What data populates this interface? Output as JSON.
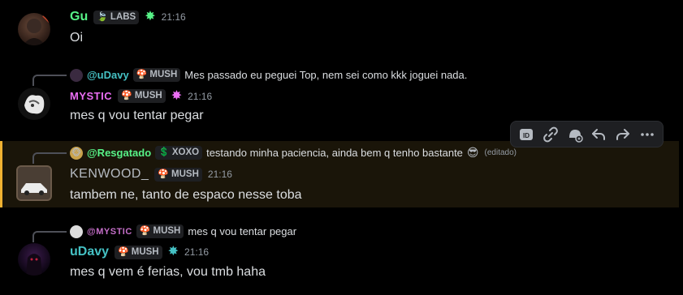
{
  "messages": [
    {
      "author": "Gu",
      "author_color": "#57f287",
      "tag": {
        "icon": "leaf-icon",
        "label": "LABS"
      },
      "badge": "green-star-icon",
      "time": "21:16",
      "content": "Oi"
    },
    {
      "reply": {
        "author": "@uDavy",
        "author_color": "#45c1c4",
        "tag": "MUSH",
        "text": "Mes passado eu peguei Top, nem sei como kkk joguei nada."
      },
      "author": "MYSTIC",
      "author_color": "#eb6ef4",
      "tag": {
        "icon": "mushroom-icon",
        "label": "MUSH"
      },
      "badge": "pink-star-icon",
      "time": "21:16",
      "content": "mes q vou tentar pegar"
    },
    {
      "reply": {
        "author": "@Resgatado",
        "author_color": "#57f287",
        "tag": "XOXO",
        "text": "testando minha paciencia, ainda bem q tenho bastante",
        "edited": "(editado)"
      },
      "author": "KENWOOD_",
      "author_color": "#b5bac1",
      "tag": {
        "icon": "mushroom-icon",
        "label": "MUSH"
      },
      "time": "21:16",
      "content": "tambem ne, tanto de espaco nesse toba"
    },
    {
      "reply": {
        "author": "@MYSTIC",
        "author_color": "#c56fc9",
        "tag": "MUSH",
        "text": "mes q vou tentar pegar"
      },
      "author": "uDavy",
      "author_color": "#45c1c4",
      "tag": {
        "icon": "mushroom-icon",
        "label": "MUSH"
      },
      "badge": "cyan-star-icon",
      "time": "21:16",
      "content": "mes q vem é ferias, vou tmb haha"
    }
  ],
  "toolbar": {
    "buttons": [
      "id-icon",
      "link-icon",
      "thread-icon",
      "reply-icon",
      "forward-icon",
      "more-icon"
    ]
  },
  "colors": {
    "background": "#000000",
    "highlight": "#1a1509",
    "highlight_border": "#f0b232"
  }
}
